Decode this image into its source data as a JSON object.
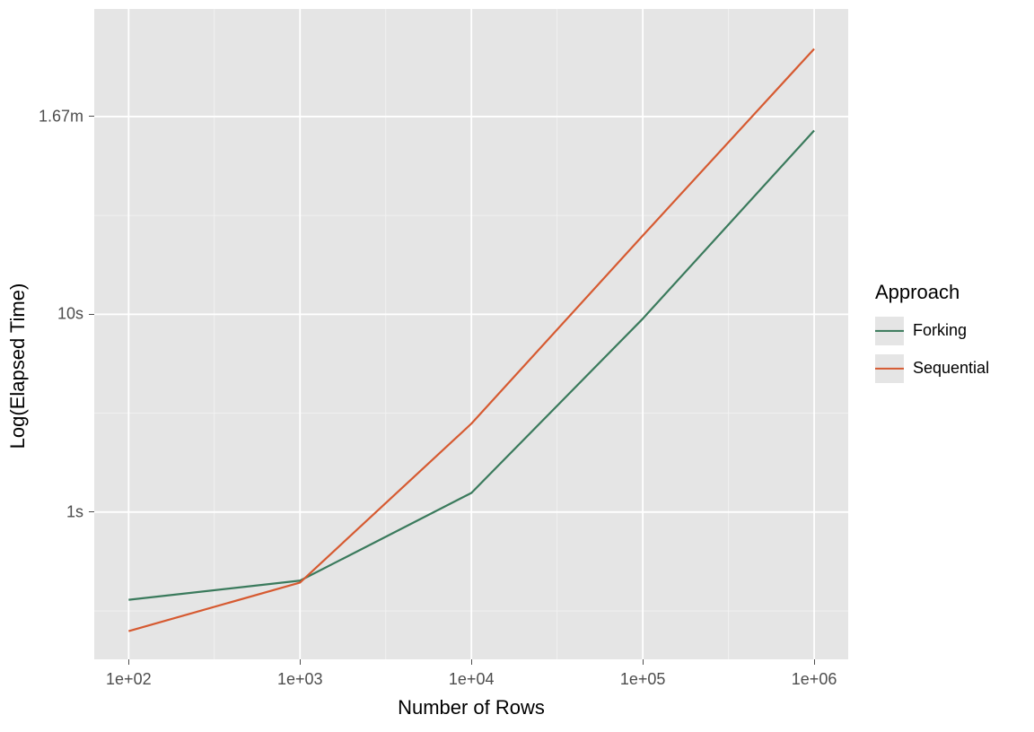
{
  "chart_data": {
    "type": "line",
    "xlabel": "Number of Rows",
    "ylabel": "Log(Elapsed Time)",
    "x_ticks": [
      "1e+02",
      "1e+03",
      "1e+04",
      "1e+05",
      "1e+06"
    ],
    "y_ticks": [
      "1s",
      "10s",
      "1.67m"
    ],
    "x_scale": "log10",
    "y_scale": "log10",
    "x_values": [
      100,
      1000,
      10000,
      100000,
      1000000
    ],
    "series": [
      {
        "name": "Forking",
        "color": "#3a7a5c",
        "values_seconds": [
          0.36,
          0.45,
          1.25,
          9.5,
          85
        ]
      },
      {
        "name": "Sequential",
        "color": "#d65a31",
        "values_seconds": [
          0.25,
          0.44,
          2.8,
          25,
          220
        ]
      }
    ],
    "legend_title": "Approach",
    "y_range_seconds": [
      0.18,
      350
    ],
    "x_range": [
      63,
      1580000
    ]
  },
  "labels": {
    "xlabel": "Number of Rows",
    "ylabel": "Log(Elapsed Time)",
    "legend_title": "Approach",
    "legend_items": {
      "0": "Forking",
      "1": "Sequential"
    }
  }
}
